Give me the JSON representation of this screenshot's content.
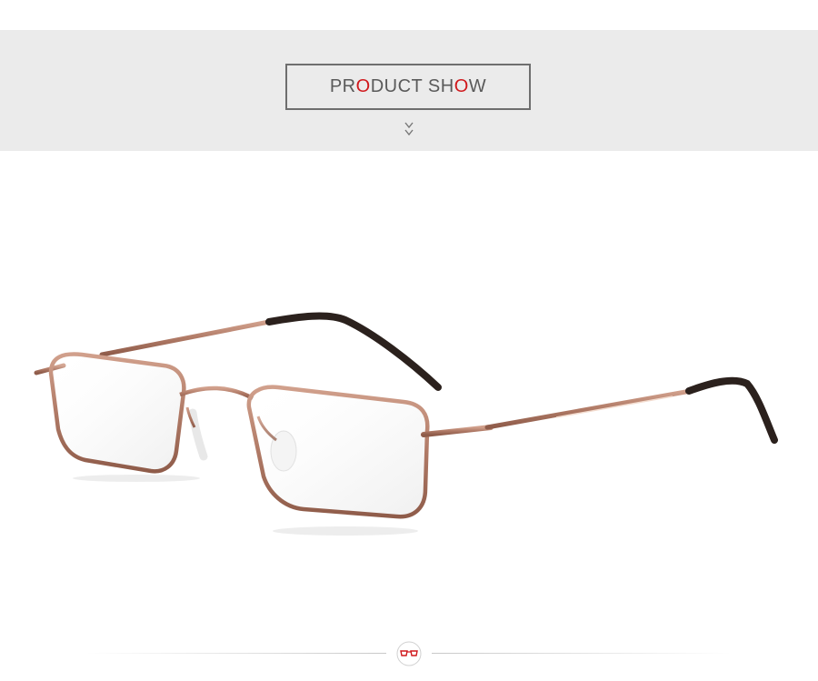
{
  "header": {
    "title_parts": [
      "PR",
      "O",
      "DUCT SH",
      "O",
      "W"
    ],
    "accent_color": "#d0181c",
    "scroll_icon": "double-chevron-down-icon"
  },
  "product": {
    "frame_color": "#b07a66",
    "temple_tip_color": "#2b211d"
  },
  "footer": {
    "badge_icon": "glasses-logo-icon"
  }
}
